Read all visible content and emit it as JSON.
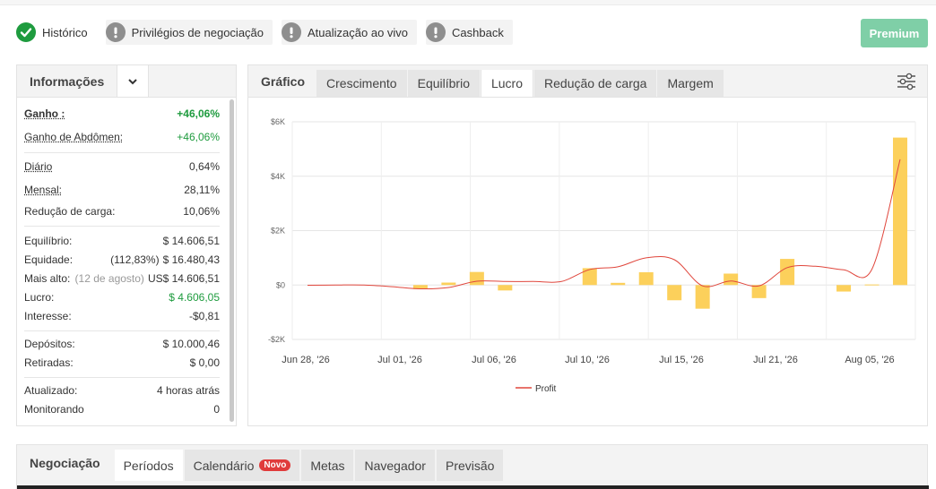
{
  "badges": [
    {
      "label": "Histórico",
      "status": "ok"
    },
    {
      "label": "Privilégios de negociação",
      "status": "warn"
    },
    {
      "label": "Atualização ao vivo",
      "status": "warn"
    },
    {
      "label": "Cashback",
      "status": "warn"
    }
  ],
  "premium_label": "Premium",
  "info": {
    "title": "Informações",
    "rows": {
      "ganho": {
        "label": "Ganho :",
        "value": "+46,06%"
      },
      "ganho_abd": {
        "label": "Ganho de Abdômen:",
        "value": "+46,06%"
      },
      "diario": {
        "label": "Diário",
        "value": "0,64%"
      },
      "mensal": {
        "label": "Mensal:",
        "value": "28,11%"
      },
      "reducao": {
        "label": "Redução de carga:",
        "value": "10,06%"
      },
      "equilibrio": {
        "label": "Equilíbrio:",
        "value": "$ 14.606,51"
      },
      "equidade": {
        "label": "Equidade:",
        "note": "(112,83%)",
        "value": "$ 16.480,43"
      },
      "mais_alto": {
        "label": "Mais alto:",
        "note": "(12 de agosto)",
        "value": "US$ 14.606,51"
      },
      "lucro": {
        "label": "Lucro:",
        "value": "$ 4.606,05"
      },
      "interesse": {
        "label": "Interesse:",
        "value": "-$0,81"
      },
      "depositos": {
        "label": "Depósitos:",
        "value": "$ 10.000,46"
      },
      "retiradas": {
        "label": "Retiradas:",
        "value": "$ 0,00"
      },
      "atualizado": {
        "label": "Atualizado:",
        "value": "4 horas atrás"
      },
      "monitorando": {
        "label": "Monitorando",
        "value": "0"
      }
    }
  },
  "chart_tabs": {
    "head": "Gráfico",
    "items": [
      "Crescimento",
      "Equilíbrio",
      "Lucro",
      "Redução de carga",
      "Margem"
    ],
    "active": "Lucro"
  },
  "bottom_tabs": {
    "head": "Negociação",
    "items": [
      "Períodos",
      "Calendário",
      "Metas",
      "Navegador",
      "Previsão"
    ],
    "active": "Períodos",
    "new_badge": "Novo"
  },
  "colors": {
    "bar": "#fcd05b",
    "line": "#e0463c",
    "ok": "#1e9b3e",
    "accent": "#7fcfa7"
  },
  "chart_data": {
    "type": "bar",
    "x_ticks": [
      "Jun 28, '26",
      "Jul 01, '26",
      "Jul 06, '26",
      "Jul 10, '26",
      "Jul 15, '26",
      "Jul 21, '26",
      "Aug 05, '26"
    ],
    "y_ticks": [
      "$6K",
      "$4K",
      "$2K",
      "$0",
      "-$2K"
    ],
    "ylim": [
      -2000,
      6000
    ],
    "legend": "Profit",
    "grid": true,
    "series": [
      {
        "type": "bar",
        "values": [
          0,
          0,
          0,
          0,
          -150,
          90,
          480,
          -200,
          0,
          0,
          620,
          80,
          470,
          -560,
          -870,
          420,
          -480,
          960,
          0,
          -240,
          20,
          5420
        ]
      },
      {
        "type": "line",
        "values": [
          -10,
          0,
          0,
          -60,
          -140,
          -90,
          140,
          130,
          130,
          130,
          570,
          670,
          1000,
          930,
          -30,
          150,
          -30,
          640,
          690,
          560,
          580,
          4620
        ]
      }
    ]
  }
}
